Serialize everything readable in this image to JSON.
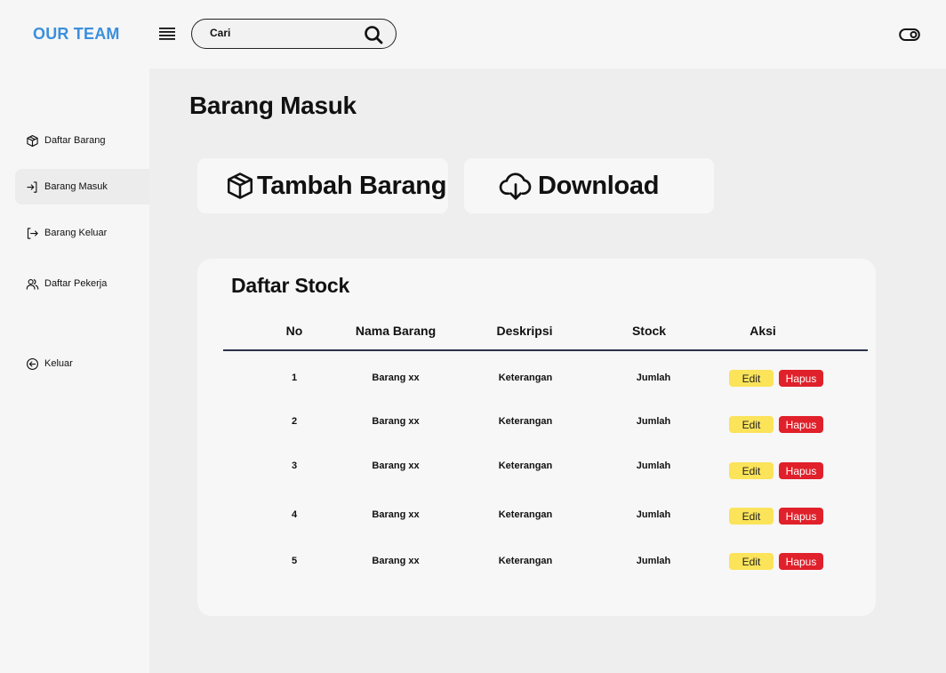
{
  "header": {
    "brand": "OUR TEAM",
    "search_placeholder": "Cari",
    "brand_color": "#3b8fdc"
  },
  "sidebar": {
    "items": [
      {
        "label": "Daftar Barang",
        "icon": "box-icon",
        "active": false
      },
      {
        "label": "Barang Masuk",
        "icon": "log-in-icon",
        "active": true
      },
      {
        "label": "Barang Keluar",
        "icon": "log-out-icon",
        "active": false
      },
      {
        "label": "Daftar Pekerja",
        "icon": "users-icon",
        "active": false
      },
      {
        "label": "Keluar",
        "icon": "arrow-left-circle-icon",
        "active": false
      }
    ]
  },
  "main": {
    "title": "Barang Masuk",
    "actions": {
      "add_label": "Tambah Barang",
      "download_label": "Download"
    },
    "stock": {
      "title": "Daftar Stock",
      "columns": [
        "No",
        "Nama Barang",
        "Deskripsi",
        "Stock",
        "Aksi"
      ],
      "rows": [
        {
          "no": "1",
          "name": "Barang xx",
          "desc": "Keterangan",
          "stock": "Jumlah"
        },
        {
          "no": "2",
          "name": "Barang xx",
          "desc": "Keterangan",
          "stock": "Jumlah"
        },
        {
          "no": "3",
          "name": "Barang xx",
          "desc": "Keterangan",
          "stock": "Jumlah"
        },
        {
          "no": "4",
          "name": "Barang xx",
          "desc": "Keterangan",
          "stock": "Jumlah"
        },
        {
          "no": "5",
          "name": "Barang xx",
          "desc": "Keterangan",
          "stock": "Jumlah"
        }
      ],
      "edit_label": "Edit",
      "delete_label": "Hapus",
      "edit_color": "#fbe35a",
      "delete_color": "#e0202a"
    }
  }
}
